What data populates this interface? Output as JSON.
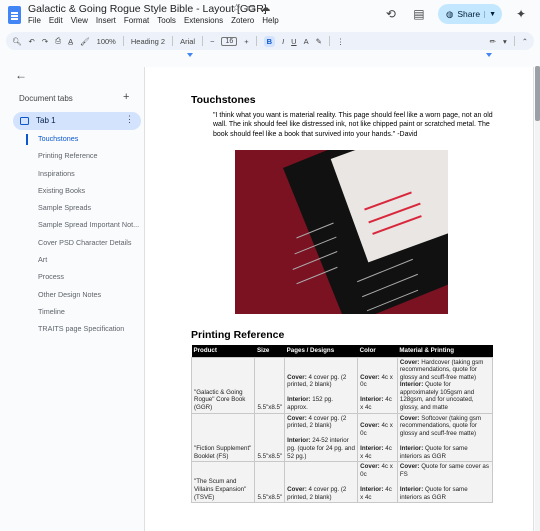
{
  "app": {
    "doc_title": "Galactic & Going Rogue Style Bible - Layout [GGR]",
    "menu": [
      "File",
      "Edit",
      "View",
      "Insert",
      "Format",
      "Tools",
      "Extensions",
      "Zotero",
      "Help"
    ],
    "share_label": "Share"
  },
  "toolbar": {
    "zoom": "100%",
    "style": "Heading 2",
    "font": "Arial",
    "font_size": "16",
    "minus": "−",
    "plus": "+",
    "bold": "B",
    "italic": "I",
    "underline": "U",
    "text_color": "A"
  },
  "sidebar": {
    "tabs_header": "Document tabs",
    "tab_label": "Tab 1",
    "outline": [
      "Touchstones",
      "Printing Reference",
      "Inspirations",
      "Existing Books",
      "Sample Spreads",
      "Sample Spread Important Not...",
      "Cover PSD Character Details",
      "Art",
      "Process",
      "Other Design Notes",
      "Timeline",
      "TRAITS page Specification"
    ]
  },
  "doc": {
    "heading1": "Touchstones",
    "quote": "\"I think what you want is material reality. This page should feel like a worn page, not an old wall. The ink should feel like distressed ink, not like chipped paint or scratched metal. The book should feel like a book that survived into your hands.\" -David",
    "heading2": "Printing Reference",
    "table": {
      "headers": [
        "Product",
        "Size",
        "Pages / Designs",
        "Color",
        "Material & Printing"
      ],
      "rows": [
        {
          "product": "\"Galactic & Going Rogue\" Core Book (GGR)",
          "size": "5.5\"x8.5\"",
          "pages_label_1": "Cover:",
          "pages_text_1": " 4 cover pg. (2 printed, 2 blank)",
          "pages_label_2": "Interior:",
          "pages_text_2": " 152 pg. approx.",
          "color_label_1": "Cover:",
          "color_text_1": " 4c x 0c",
          "color_label_2": "Interior:",
          "color_text_2": " 4c x 4c",
          "mat_label_1": "Cover:",
          "mat_text_1": " Hardcover (taking gsm recommendations, quote for glossy and scuff-free matte)",
          "mat_label_2": "Interior:",
          "mat_text_2": " Quote for approximately 105gsm and 128gsm, and for uncoated, glossy, and matte"
        },
        {
          "product": "\"Fiction Supplement\" Booklet (FS)",
          "size": "5.5\"x8.5\"",
          "pages_label_1": "Cover:",
          "pages_text_1": " 4 cover pg. (2 printed, 2 blank)",
          "pages_label_2": "Interior:",
          "pages_text_2": " 24-52 interior pg. (quote for 24 pg. and 52 pg.)",
          "color_label_1": "Cover:",
          "color_text_1": " 4c x 0c",
          "color_label_2": "Interior:",
          "color_text_2": " 4c x 4c",
          "mat_label_1": "Cover:",
          "mat_text_1": " Softcover (taking gsm recommendations, quote for glossy and scuff-free matte)",
          "mat_label_2": "Interior:",
          "mat_text_2": " Quote for same interiors as GGR"
        },
        {
          "product": "\"The Scum and Villains Expansion\" (TSVE)",
          "size": "5.5\"x8.5\"",
          "pages_label_1": "Cover:",
          "pages_text_1": " 4 cover pg. (2 printed, 2 blank)",
          "color_label_1": "Cover:",
          "color_text_1": " 4c x 0c",
          "color_label_2": "Interior:",
          "color_text_2": " 4c x 4c",
          "mat_label_1": "Cover:",
          "mat_text_1": " Quote for same cover as FS",
          "mat_label_2": "Interior:",
          "mat_text_2": " Quote for same interiors as GGR"
        }
      ]
    }
  },
  "colors": {
    "accent": "#0b57d0",
    "share_bg": "#c2e7ff",
    "tab_bg": "#d3e3fd",
    "photo_bg": "#7a1222"
  }
}
